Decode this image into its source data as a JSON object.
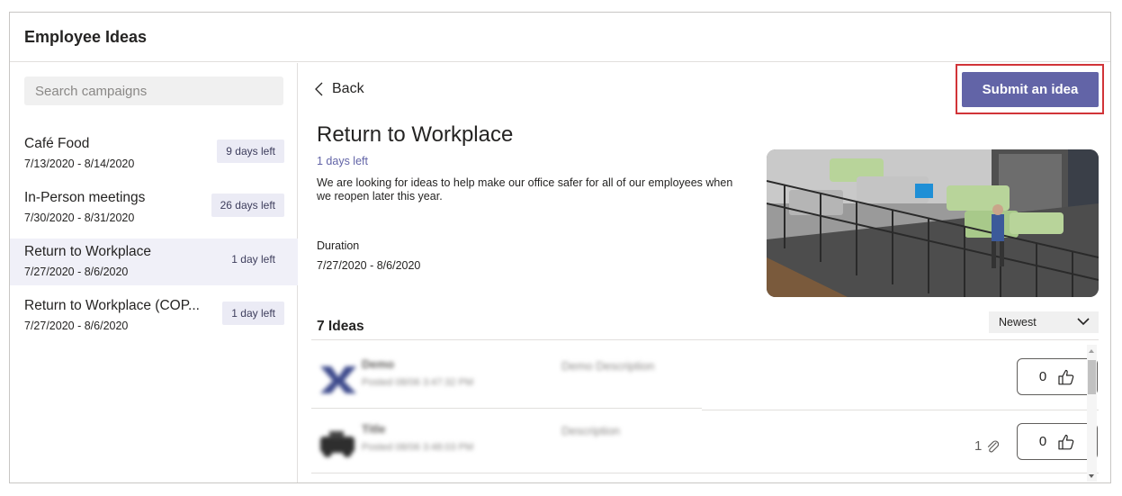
{
  "app": {
    "title": "Employee Ideas"
  },
  "search": {
    "placeholder": "Search campaigns"
  },
  "campaigns": [
    {
      "name": "Café Food",
      "dates": "7/13/2020 - 8/14/2020",
      "badge": "9 days left",
      "selected": false
    },
    {
      "name": "In-Person meetings",
      "dates": "7/30/2020 - 8/31/2020",
      "badge": "26 days left",
      "selected": false
    },
    {
      "name": "Return to Workplace",
      "dates": "7/27/2020 - 8/6/2020",
      "badge": "1 day left",
      "selected": true
    },
    {
      "name": "Return to Workplace (COP...",
      "dates": "7/27/2020 - 8/6/2020",
      "badge": "1 day left",
      "selected": false
    }
  ],
  "detail": {
    "back_label": "Back",
    "submit_label": "Submit an idea",
    "title": "Return to Workplace",
    "days_left": "1 days left",
    "description": "We are looking for ideas to help make our office safer for all of our employees when we reopen later this year.",
    "duration_label": "Duration",
    "duration_value": "7/27/2020 - 8/6/2020",
    "ideas_count": "7 Ideas",
    "sort_selected": "Newest"
  },
  "ideas": [
    {
      "title": "Demo",
      "meta": "Posted 08/06 3:47:32 PM",
      "description": "Demo Description",
      "likes": "0",
      "attachments": ""
    },
    {
      "title": "Title",
      "meta": "Posted 08/06 3:48:03 PM",
      "description": "Description",
      "likes": "0",
      "attachments": "1"
    }
  ],
  "colors": {
    "accent": "#6264a7",
    "highlight_outline": "#d13438",
    "selected_bg": "#f0f0f8",
    "badge_bg": "#ebebf5"
  },
  "icons": {
    "back": "chevron-left-icon",
    "sort": "chevron-down-icon",
    "like": "thumbs-up-icon",
    "attachment": "paperclip-icon"
  }
}
